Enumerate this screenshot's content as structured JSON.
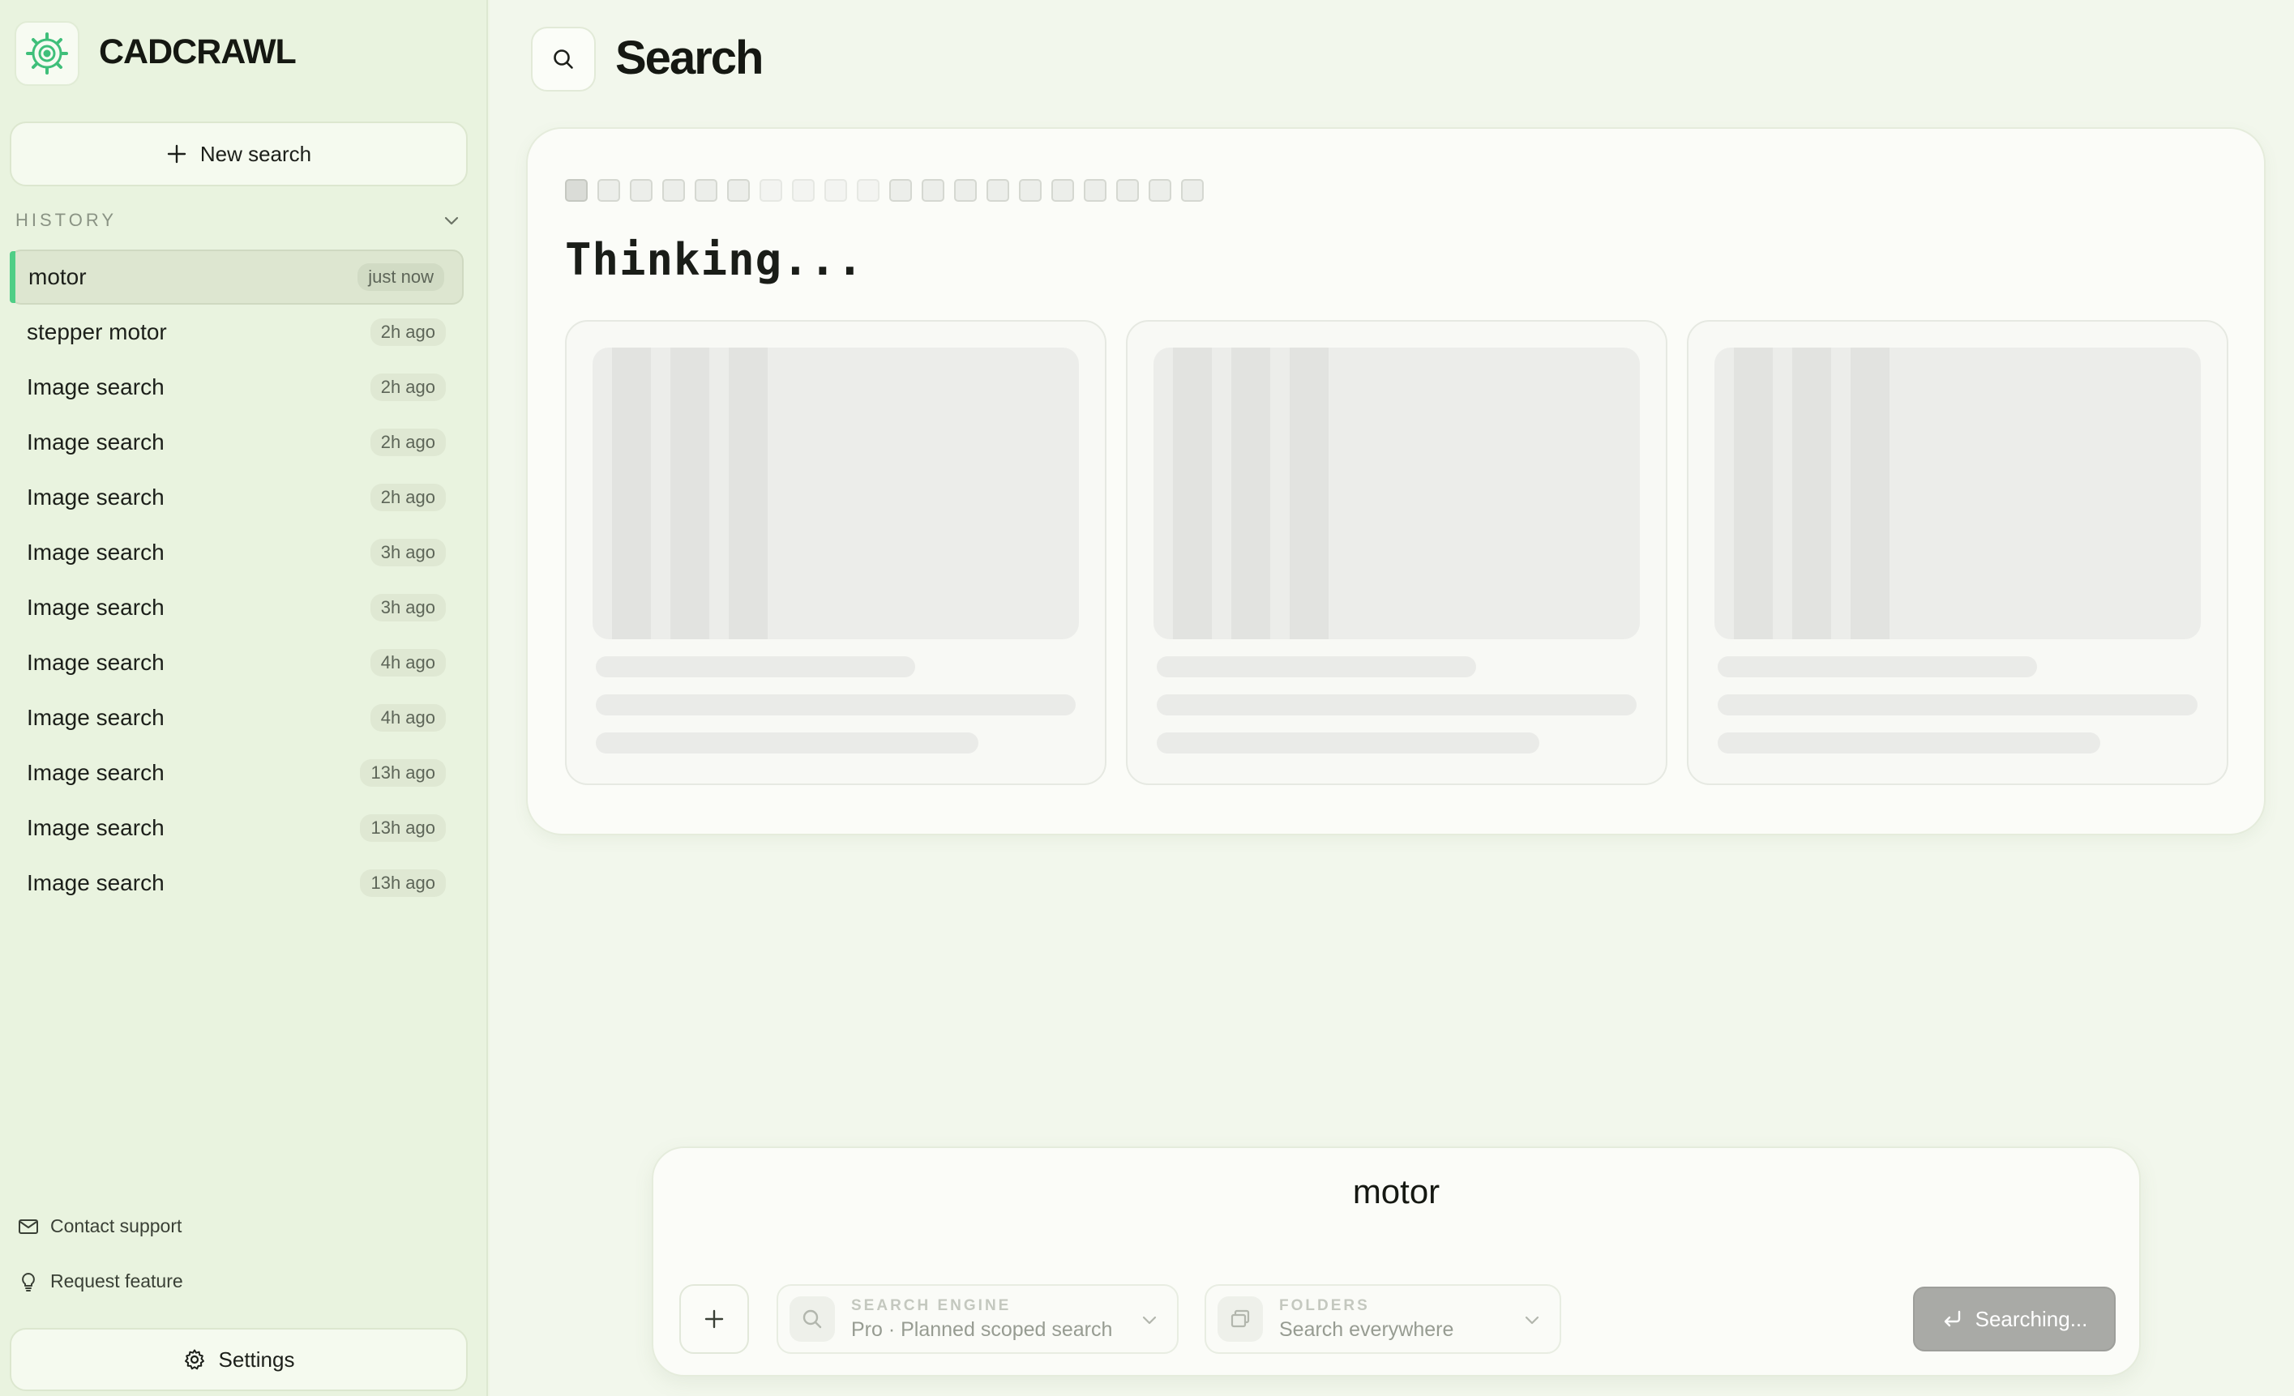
{
  "app": {
    "brand": "CADCRAWL"
  },
  "sidebar": {
    "new_search_label": "New search",
    "history_label": "HISTORY",
    "items": [
      {
        "label": "motor",
        "time": "just now",
        "active": true
      },
      {
        "label": "stepper motor",
        "time": "2h ago"
      },
      {
        "label": "Image search",
        "time": "2h ago"
      },
      {
        "label": "Image search",
        "time": "2h ago"
      },
      {
        "label": "Image search",
        "time": "2h ago"
      },
      {
        "label": "Image search",
        "time": "3h ago"
      },
      {
        "label": "Image search",
        "time": "3h ago"
      },
      {
        "label": "Image search",
        "time": "4h ago"
      },
      {
        "label": "Image search",
        "time": "4h ago"
      },
      {
        "label": "Image search",
        "time": "13h ago"
      },
      {
        "label": "Image search",
        "time": "13h ago"
      },
      {
        "label": "Image search",
        "time": "13h ago"
      }
    ],
    "contact_support": "Contact support",
    "request_feature": "Request feature",
    "settings_label": "Settings"
  },
  "header": {
    "title": "Search"
  },
  "results": {
    "status": "Thinking...",
    "progress_squares": 20,
    "placeholder_cards": 3
  },
  "composer": {
    "query": "motor",
    "engine": {
      "label": "SEARCH ENGINE",
      "value": "Pro · Planned scoped search"
    },
    "folders": {
      "label": "FOLDERS",
      "value": "Search everywhere"
    },
    "submit_label": "Searching..."
  },
  "colors": {
    "accent": "#4fce86",
    "sidebar_bg": "#e9f3df",
    "main_bg": "#f2f7ec",
    "disabled_button": "#a9aaa6"
  }
}
